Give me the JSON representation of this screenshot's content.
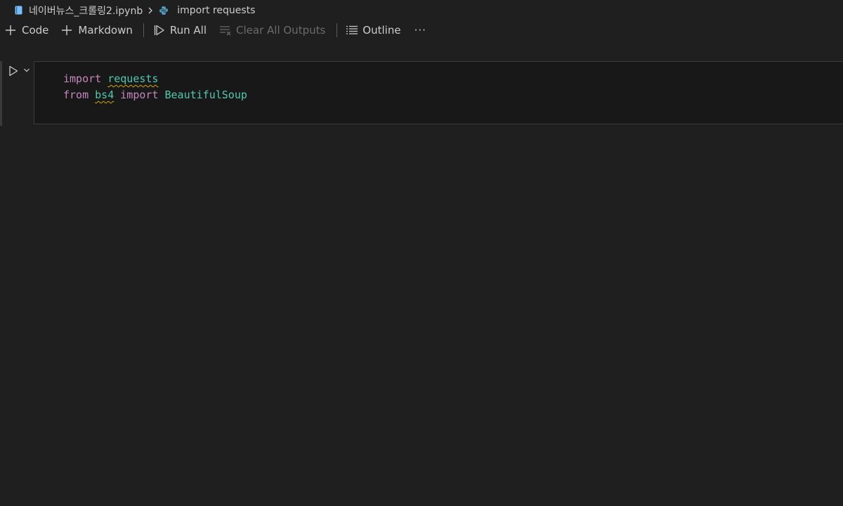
{
  "breadcrumb": {
    "file_icon": "notebook-file-icon",
    "file_name": "네이버뉴스_크롤링2.ipynb",
    "separator_icon": "chevron-right-icon",
    "symbol_icon": "python-icon",
    "symbol_name": "import requests"
  },
  "toolbar": {
    "code_label": "Code",
    "markdown_label": "Markdown",
    "run_all_label": "Run All",
    "clear_outputs_label": "Clear All Outputs",
    "outline_label": "Outline",
    "more_label": "···"
  },
  "cell": {
    "lines": [
      {
        "kw1": "import",
        "mod1": "requests"
      },
      {
        "kw1": "from",
        "mod1": "bs4",
        "kw2": "import",
        "mod2": "BeautifulSoup"
      }
    ]
  },
  "colors": {
    "background": "#1f1f1f",
    "editor_background": "#181818",
    "keyword": "#c586c0",
    "module": "#4ec9b0",
    "warning_squiggle": "#cca700",
    "python_icon": "#519aba"
  }
}
